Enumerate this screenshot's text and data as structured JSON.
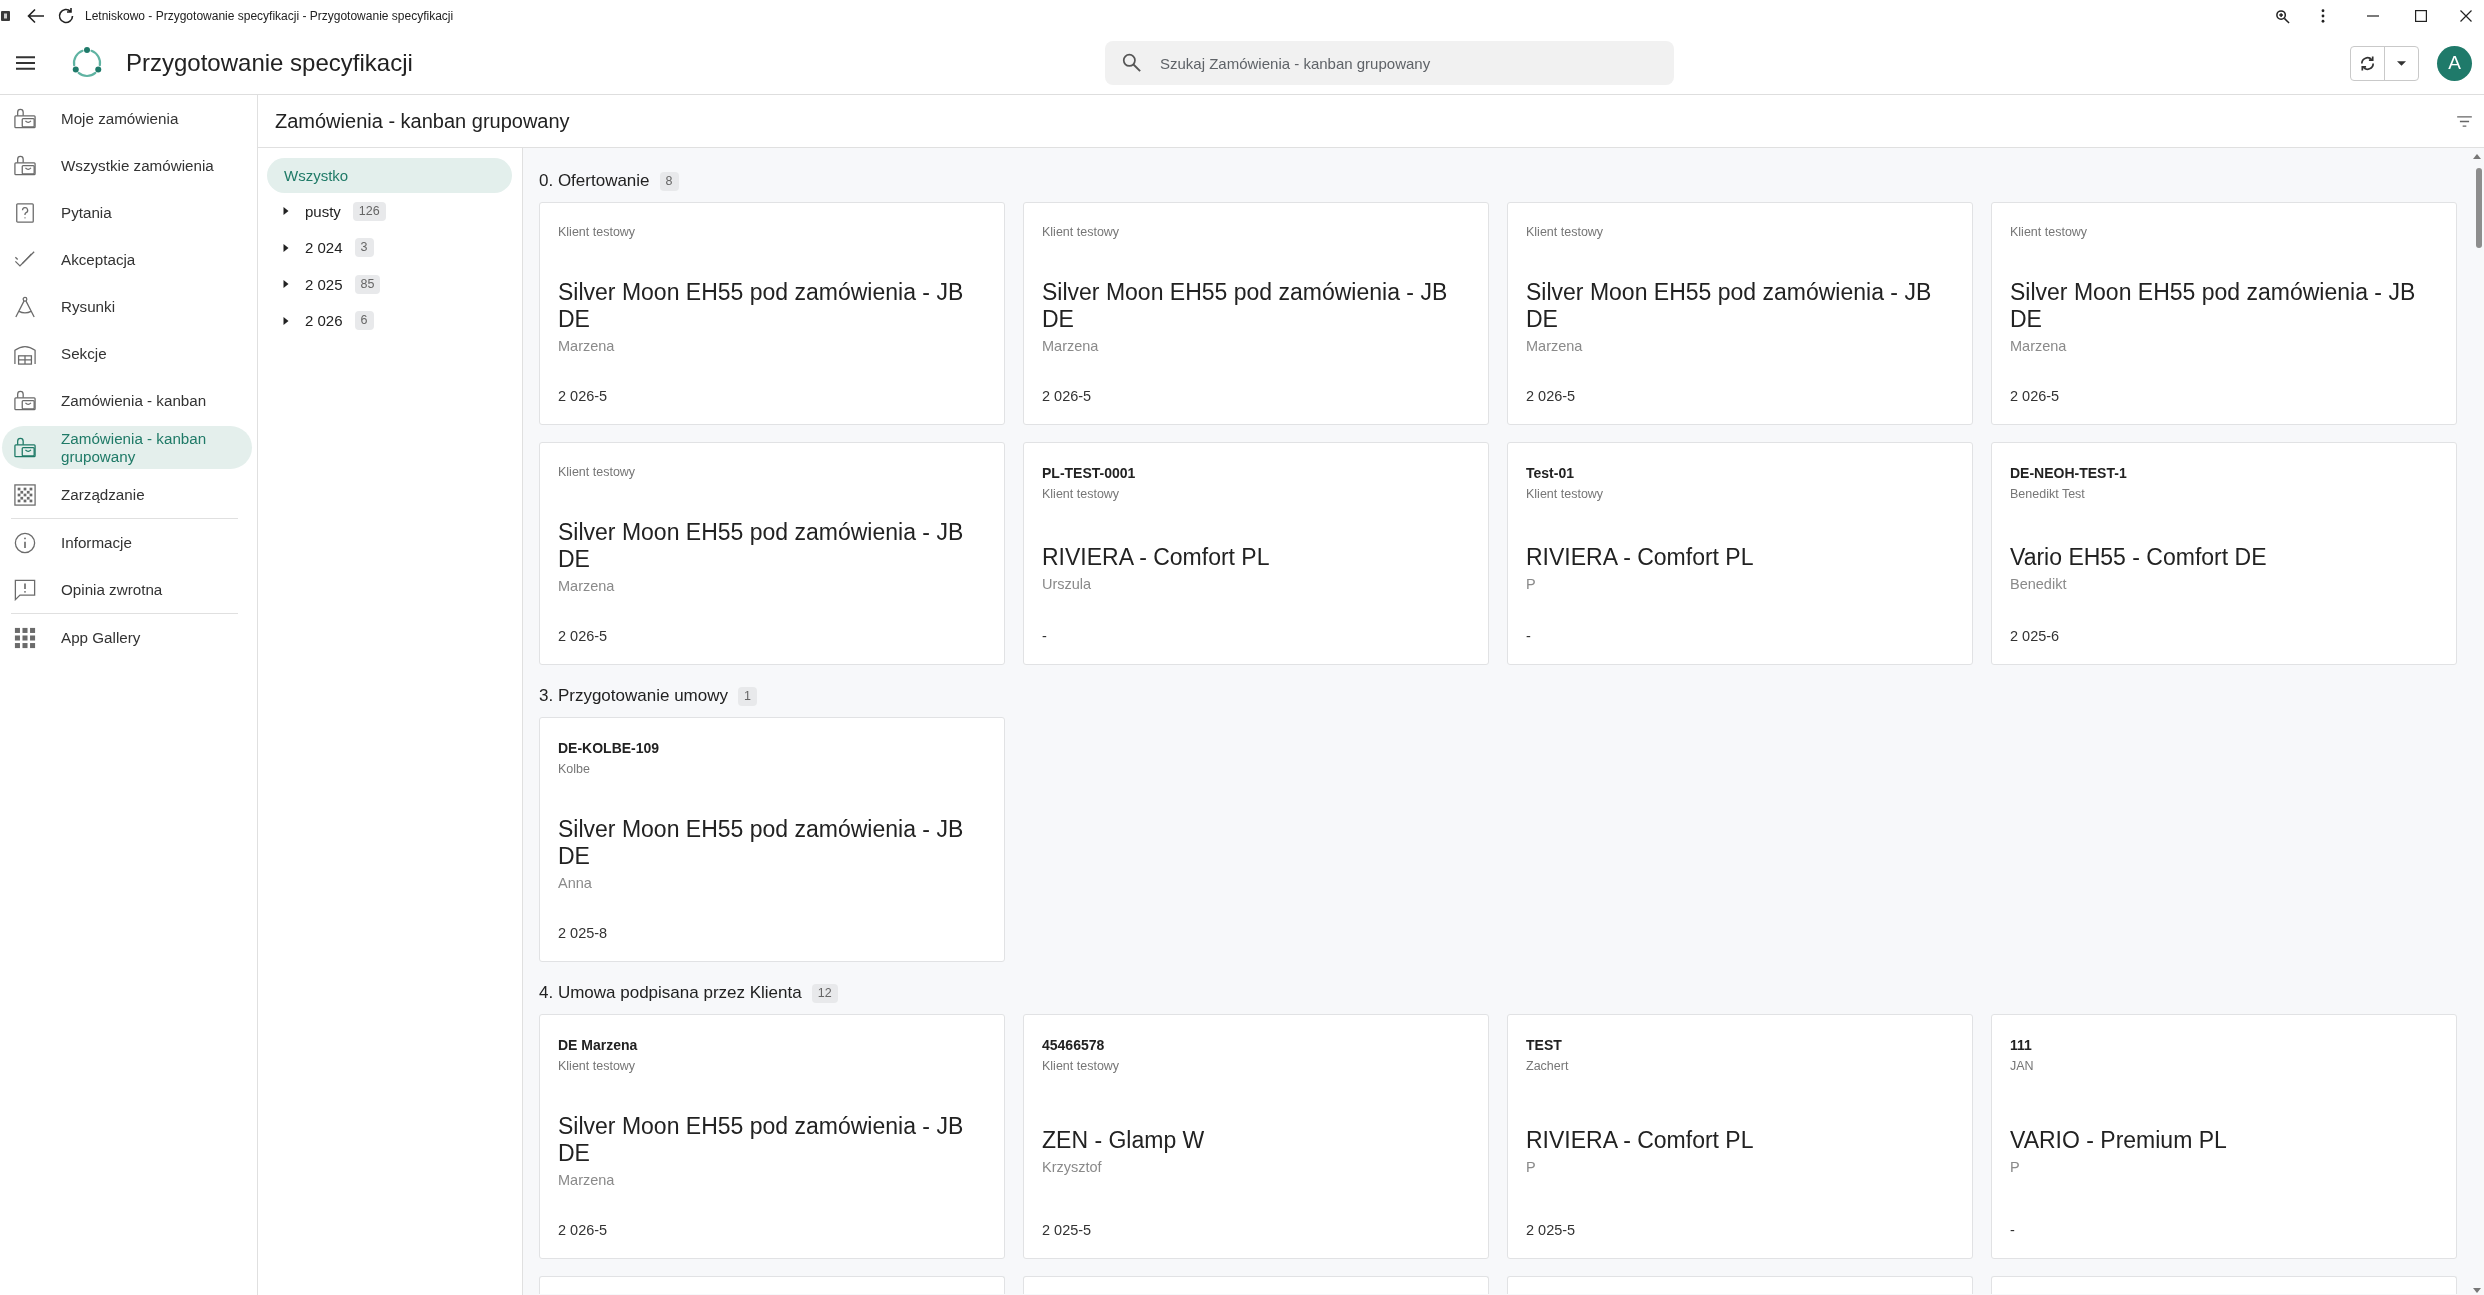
{
  "browser": {
    "title": "Letniskowo - Przygotowanie specyfikacji - Przygotowanie specyfikacji"
  },
  "app_bar": {
    "title": "Przygotowanie specyfikacji",
    "search": {
      "placeholder": "Szukaj Zamówienia - kanban grupowany"
    },
    "avatar": "A"
  },
  "sidebar": {
    "sections": [
      {
        "items": [
          {
            "label": "Moje zamówienia",
            "selected": false
          },
          {
            "label": "Wszystkie zamówienia",
            "selected": false
          },
          {
            "label": "Pytania",
            "selected": false
          },
          {
            "label": "Akceptacja",
            "selected": false
          },
          {
            "label": "Rysunki",
            "selected": false
          },
          {
            "label": "Sekcje",
            "selected": false
          },
          {
            "label": "Zamówienia - kanban",
            "selected": false
          },
          {
            "label": "Zamówienia - kanban grupowany",
            "selected": true
          },
          {
            "label": "Zarządzanie",
            "selected": false
          }
        ]
      },
      {
        "items": [
          {
            "label": "Informacje",
            "selected": false
          },
          {
            "label": "Opinia zwrotna",
            "selected": false
          }
        ]
      },
      {
        "items": [
          {
            "label": "App Gallery",
            "selected": false
          }
        ]
      }
    ]
  },
  "page": {
    "title": "Zamówienia - kanban grupowany"
  },
  "tree": {
    "all": {
      "label": "Wszystko",
      "selected": true
    },
    "items": [
      {
        "label": "pusty",
        "count": "126",
        "expanded": false,
        "selected": false
      },
      {
        "label": "2 024",
        "count": "3",
        "expanded": false,
        "selected": false
      },
      {
        "label": "2 025",
        "count": "85",
        "expanded": false,
        "selected": false
      },
      {
        "label": "2 026",
        "count": "6",
        "expanded": false,
        "selected": false
      }
    ]
  },
  "board": {
    "groups": [
      {
        "title": "0. Ofertowanie",
        "count": "8",
        "cards": [
          {
            "kind": "full",
            "client": "Klient testowy",
            "title": "Silver Moon EH55 pod zamówienia - JB DE",
            "person": "Marzena",
            "date": "2 026-5"
          },
          {
            "kind": "full",
            "client": "Klient testowy",
            "title": "Silver Moon EH55 pod zamówienia - JB DE",
            "person": "Marzena",
            "date": "2 026-5"
          },
          {
            "kind": "full",
            "client": "Klient testowy",
            "title": "Silver Moon EH55 pod zamówienia - JB DE",
            "person": "Marzena",
            "date": "2 026-5"
          },
          {
            "kind": "full",
            "client": "Klient testowy",
            "title": "Silver Moon EH55 pod zamówienia - JB DE",
            "person": "Marzena",
            "date": "2 026-5"
          },
          {
            "kind": "full",
            "client": "Klient testowy",
            "title": "Silver Moon EH55 pod zamówienia - JB DE",
            "person": "Marzena",
            "date": "2 026-5"
          },
          {
            "kind": "full",
            "code": "PL-TEST-0001",
            "client": "Klient testowy",
            "title": "RIVIERA - Comfort PL",
            "person": "Urszula",
            "date": "-"
          },
          {
            "kind": "full",
            "code": "Test-01",
            "client": "Klient testowy",
            "title": "RIVIERA - Comfort PL",
            "person": "P",
            "date": "-"
          },
          {
            "kind": "full",
            "code": "DE-NEOH-TEST-1",
            "client": "Benedikt Test",
            "title": "Vario EH55 - Comfort DE",
            "person": "Benedikt",
            "date": "2 025-6"
          }
        ]
      },
      {
        "title": "3. Przygotowanie umowy",
        "count": "1",
        "cards": [
          {
            "kind": "full",
            "code": "DE-KOLBE-109",
            "client": "Kolbe",
            "title": "Silver Moon EH55 pod zamówienia - JB DE",
            "person": "Anna",
            "date": "2 025-8"
          }
        ]
      },
      {
        "title": "4. Umowa podpisana przez Klienta",
        "count": "12",
        "cards": [
          {
            "kind": "full",
            "code": "DE Marzena",
            "client": "Klient testowy",
            "title": "Silver Moon EH55 pod zamówienia - JB DE",
            "person": "Marzena",
            "date": "2 026-5"
          },
          {
            "kind": "full",
            "code": "45466578",
            "client": "Klient testowy",
            "title": "ZEN - Glamp W",
            "person": "Krzysztof",
            "date": "2 025-5"
          },
          {
            "kind": "full",
            "code": "TEST",
            "client": "Zachert",
            "title": "RIVIERA - Comfort PL",
            "person": "P",
            "date": "2 025-5"
          },
          {
            "kind": "full",
            "code": "111",
            "client": "JAN",
            "title": "VARIO - Premium PL",
            "person": "P",
            "date": "-"
          },
          {
            "kind": "clipped"
          },
          {
            "kind": "clipped"
          },
          {
            "kind": "clipped"
          },
          {
            "kind": "clipped"
          }
        ]
      }
    ]
  }
}
